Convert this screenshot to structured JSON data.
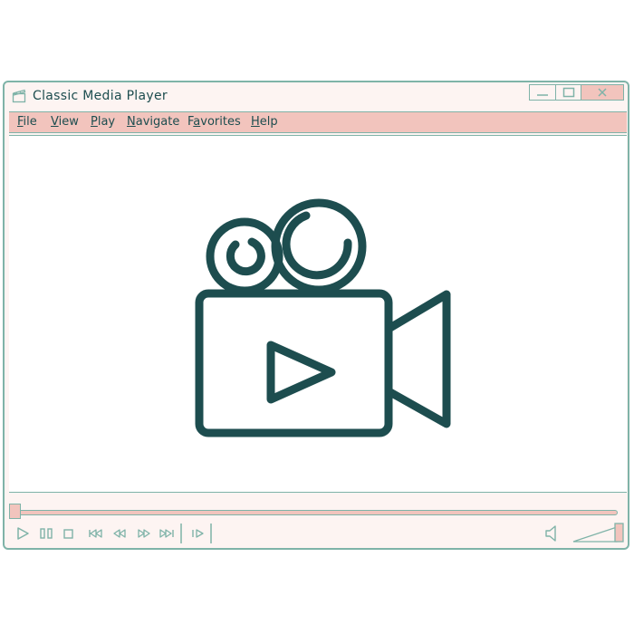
{
  "window": {
    "title": "Classic Media Player",
    "buttons": {
      "minimize": "minimize",
      "maximize": "maximize",
      "close": "close"
    }
  },
  "menu": {
    "items": [
      {
        "label_first": "F",
        "label_rest": "ile"
      },
      {
        "label_first": "V",
        "label_rest": "iew"
      },
      {
        "label_first": "P",
        "label_rest": "lay"
      },
      {
        "label_first": "N",
        "label_rest": "avigate"
      },
      {
        "label_first": "F",
        "label_rest": "avorites",
        "underline_index": 1
      },
      {
        "label_first": "H",
        "label_rest": "elp"
      }
    ]
  },
  "playback": {
    "progress": 0.0,
    "volume": 1.0
  },
  "colors": {
    "frame": "#7fb3a8",
    "accent": "#f2c4bd",
    "icon": "#1d4d4f",
    "background": "#fdf4f2"
  },
  "icons": {
    "app": "clapperboard-icon",
    "viewport": "video-camera-icon",
    "play": "play-icon",
    "pause": "pause-icon",
    "stop": "stop-icon",
    "skip_back": "skip-back-icon",
    "rewind": "rewind-icon",
    "fast_forward": "fast-forward-icon",
    "skip_forward": "skip-forward-icon",
    "frame_step": "frame-step-icon",
    "volume": "speaker-icon"
  }
}
